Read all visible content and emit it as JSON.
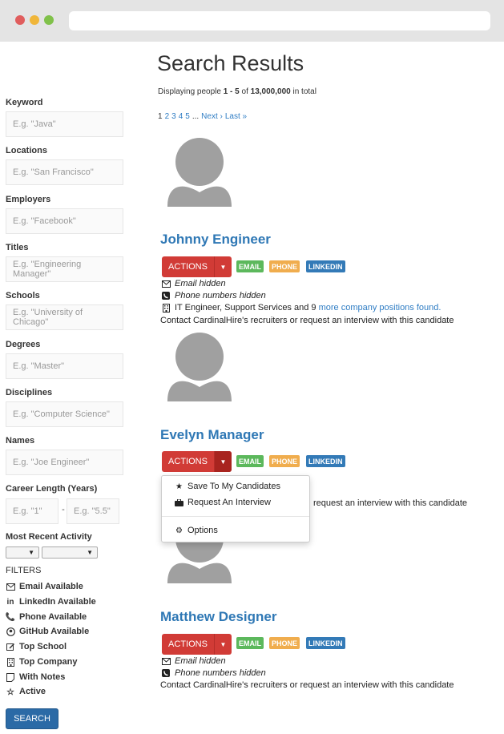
{
  "search": {
    "keyword_label": "Keyword",
    "keyword_placeholder": "E.g. \"Java\"",
    "locations_label": "Locations",
    "locations_placeholder": "E.g. \"San Francisco\"",
    "employers_label": "Employers",
    "employers_placeholder": "E.g. \"Facebook\"",
    "titles_label": "Titles",
    "titles_placeholder": "E.g. \"Engineering Manager\"",
    "schools_label": "Schools",
    "schools_placeholder": "E.g. \"University of Chicago\"",
    "degrees_label": "Degrees",
    "degrees_placeholder": "E.g. \"Master\"",
    "disciplines_label": "Disciplines",
    "disciplines_placeholder": "E.g. \"Computer Science\"",
    "names_label": "Names",
    "names_placeholder": "E.g. \"Joe Engineer\"",
    "career_label": "Career Length (Years)",
    "career_min_placeholder": "E.g. \"1\"",
    "career_sep": "-",
    "career_max_placeholder": "E.g. \"5.5\"",
    "activity_label": "Most Recent Activity",
    "select_arrow": "▼",
    "filters_head": "FILTERS",
    "filters": [
      {
        "label": "Email Available",
        "icon": "envelope-icon"
      },
      {
        "label": "LinkedIn Available",
        "icon": "linkedin-icon"
      },
      {
        "label": "Phone Available",
        "icon": "phone-icon"
      },
      {
        "label": "GitHub Available",
        "icon": "github-icon"
      },
      {
        "label": "Top School",
        "icon": "edit-icon"
      },
      {
        "label": "Top Company",
        "icon": "building-icon"
      },
      {
        "label": "With Notes",
        "icon": "note-icon"
      },
      {
        "label": "Active",
        "icon": "star-icon"
      }
    ],
    "search_button": "SEARCH"
  },
  "results": {
    "title": "Search Results",
    "summary_prefix": "Displaying people ",
    "summary_range": "1 - 5",
    "summary_mid": " of ",
    "summary_total": "13,000,000",
    "summary_suffix": " in total",
    "pager": {
      "current": "1",
      "pages": [
        "2",
        "3",
        "4",
        "5"
      ],
      "ellipsis": "...",
      "next": "Next ›",
      "last": "Last »"
    }
  },
  "candidates": [
    {
      "name": "Johnny Engineer",
      "actions_label": "ACTIONS",
      "badges": [
        "EMAIL",
        "PHONE",
        "LINKEDIN"
      ],
      "email_status": "Email hidden",
      "phone_status": "Phone numbers hidden",
      "positions_text": "IT Engineer, Support Services and 9 ",
      "positions_link": "more company positions found.",
      "contact_text": "Contact CardinalHire's recruiters or request an interview with this candidate"
    },
    {
      "name": "Evelyn Manager",
      "actions_label": "ACTIONS",
      "badges": [
        "EMAIL",
        "PHONE",
        "LINKEDIN"
      ],
      "contact_text_partial": "request an interview with this candidate"
    },
    {
      "name": "Matthew Designer",
      "actions_label": "ACTIONS",
      "badges": [
        "EMAIL",
        "PHONE",
        "LINKEDIN"
      ],
      "email_status": "Email hidden",
      "phone_status": "Phone numbers hidden",
      "contact_text": "Contact CardinalHire's recruiters or request an interview with this candidate"
    }
  ],
  "dropdown": {
    "items": [
      "Save To My Candidates",
      "Request An Interview"
    ],
    "options": "Options"
  },
  "colors": {
    "accent_blue": "#2f78b5",
    "actions_red": "#d13b36",
    "email_green": "#5cb85c",
    "phone_orange": "#f0ad4e",
    "linkedin_blue": "#337ab7"
  }
}
